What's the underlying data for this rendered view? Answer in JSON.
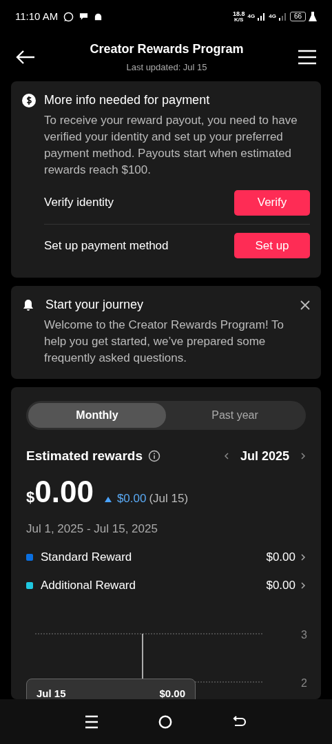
{
  "status_bar": {
    "time": "11:10 AM",
    "net_speed": "18.8",
    "net_unit": "K/S",
    "network_1": "4G",
    "network_2": "4G",
    "battery": "66"
  },
  "header": {
    "title": "Creator Rewards Program",
    "subtitle": "Last updated: Jul 15"
  },
  "payment_card": {
    "title": "More info needed for payment",
    "body": "To receive your reward payout, you need to have verified your identity and set up your preferred payment method. Payouts start when estimated rewards reach $100.",
    "actions": [
      {
        "label": "Verify identity",
        "button": "Verify"
      },
      {
        "label": "Set up payment method",
        "button": "Set up"
      }
    ]
  },
  "journey_card": {
    "title": "Start your journey",
    "body": "Welcome to the Creator Rewards Program! To help you get started, we’ve prepared some frequently asked questions."
  },
  "rewards": {
    "tabs": [
      {
        "label": "Monthly",
        "selected": true
      },
      {
        "label": "Past year",
        "selected": false
      }
    ],
    "title": "Estimated rewards",
    "period": "Jul 2025",
    "currency": "$",
    "amount": "0.00",
    "change": "$0.00",
    "change_date": "(Jul 15)",
    "range": "Jul 1, 2025 - Jul 15, 2025",
    "breakdown": [
      {
        "name": "Standard Reward",
        "value": "$0.00",
        "color": "#0a6fe0"
      },
      {
        "name": "Additional Reward",
        "value": "$0.00",
        "color": "#1fc8e0"
      }
    ],
    "chart": {
      "yticks": [
        "3",
        "2"
      ],
      "tooltip": {
        "date": "Jul 15",
        "value": "$0.00"
      }
    }
  }
}
